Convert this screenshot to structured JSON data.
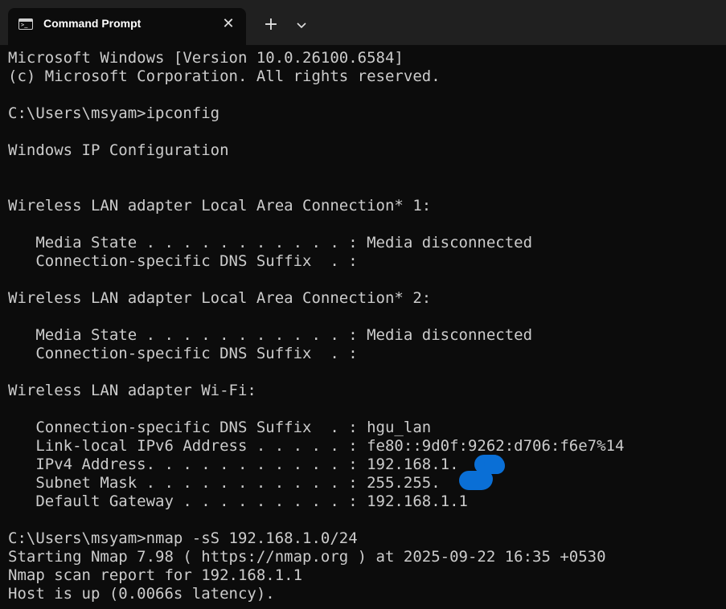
{
  "tab": {
    "title": "Command Prompt",
    "close_glyph": "✕",
    "new_tab_glyph": "+",
    "icons": {
      "tab_icon": "terminal-icon",
      "close": "close-icon",
      "new_tab": "plus-icon",
      "dropdown": "chevron-down-icon"
    }
  },
  "colors": {
    "background": "#0c0c0c",
    "titlebar": "#202020",
    "text": "#cccccc",
    "redaction": "#0a6fd6"
  },
  "console": {
    "lines": [
      "Microsoft Windows [Version 10.0.26100.6584]",
      "(c) Microsoft Corporation. All rights reserved.",
      "",
      "C:\\Users\\msyam>ipconfig",
      "",
      "Windows IP Configuration",
      "",
      "",
      "Wireless LAN adapter Local Area Connection* 1:",
      "",
      "   Media State . . . . . . . . . . . : Media disconnected",
      "   Connection-specific DNS Suffix  . :",
      "",
      "Wireless LAN adapter Local Area Connection* 2:",
      "",
      "   Media State . . . . . . . . . . . : Media disconnected",
      "   Connection-specific DNS Suffix  . :",
      "",
      "Wireless LAN adapter Wi-Fi:",
      "",
      "   Connection-specific DNS Suffix  . : hgu_lan",
      "   Link-local IPv6 Address . . . . . : fe80::9d0f:9262:d706:f6e7%14",
      "   IPv4 Address. . . . . . . . . . . : 192.168.1.",
      "   Subnet Mask . . . . . . . . . . . : 255.255.   .0",
      "   Default Gateway . . . . . . . . . : 192.168.1.1",
      "",
      "C:\\Users\\msyam>nmap -sS 192.168.1.0/24",
      "Starting Nmap 7.98 ( https://nmap.org ) at 2025-09-22 16:35 +0530",
      "Nmap scan report for 192.168.1.1",
      "Host is up (0.0066s latency)."
    ]
  }
}
